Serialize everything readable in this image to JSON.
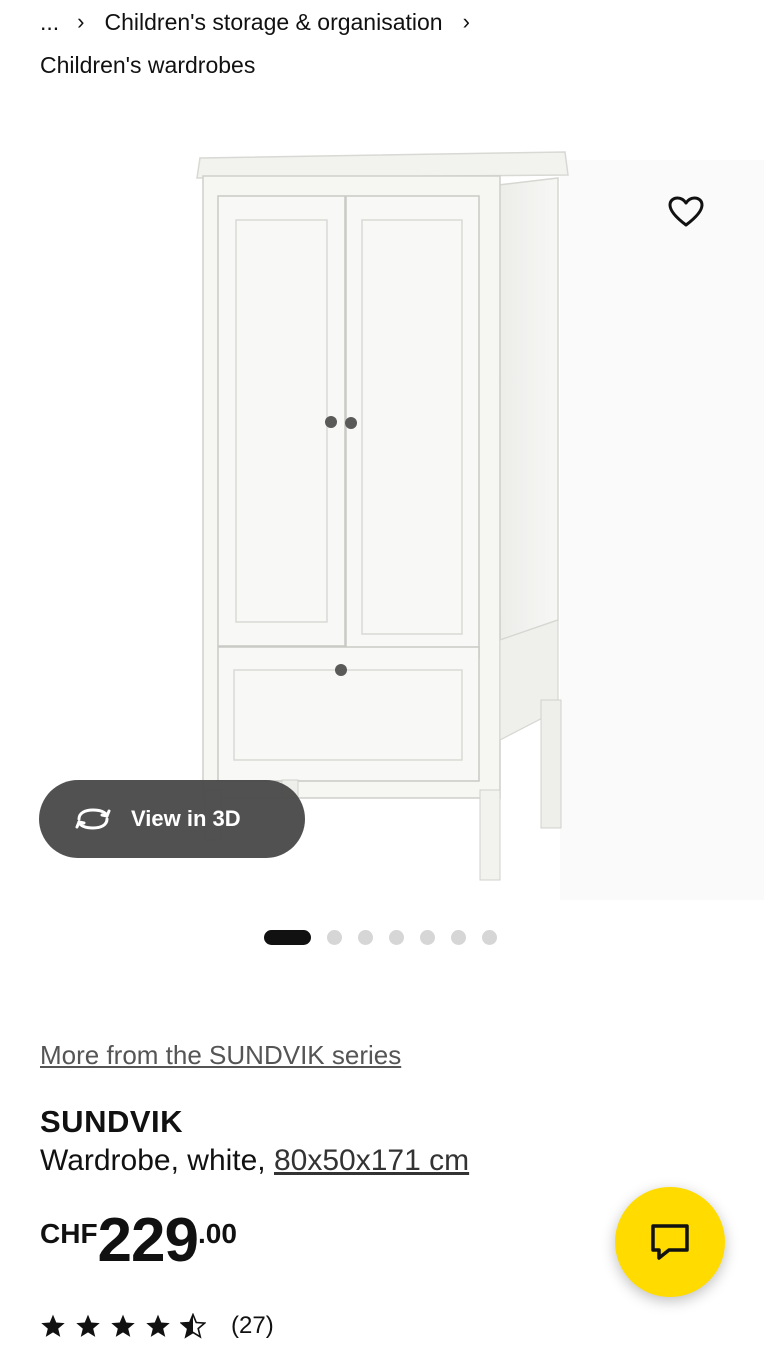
{
  "breadcrumb": {
    "ellipsis": "...",
    "parent": "Children's storage & organisation",
    "current": "Children's wardrobes"
  },
  "gallery": {
    "view_3d_label": "View in 3D",
    "slide_count": 7,
    "active_slide": 1
  },
  "product": {
    "series_link": "More from the SUNDVIK series",
    "name": "SUNDVIK",
    "description": "Wardrobe, white,",
    "dimensions": "80x50x171 cm",
    "price": {
      "currency": "CHF",
      "integer": "229",
      "decimal": ".00"
    },
    "rating": {
      "stars": 4.5,
      "count": "(27)"
    }
  },
  "colors": {
    "accent_yellow": "#ffdb00",
    "view3d_bg": "#484848"
  },
  "icons": {
    "favorite": "heart-icon",
    "view_3d": "rotate-3d-icon",
    "chat": "chat-icon",
    "chevron": "chevron-right-icon"
  }
}
